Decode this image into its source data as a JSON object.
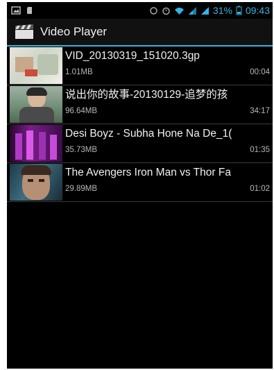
{
  "status_bar": {
    "battery_percent": "31%",
    "time": "09:43",
    "icons": [
      "image-icon",
      "sd-card-icon",
      "sync-icon",
      "alarm-icon",
      "wifi-icon",
      "signal-icon",
      "signal-icon",
      "battery-icon"
    ],
    "accent_color": "#33b5e5"
  },
  "action_bar": {
    "title": "Video Player",
    "icon": "clapperboard-icon"
  },
  "videos": [
    {
      "title": "VID_20130319_151020.3gp",
      "size": "1.01MB",
      "duration": "00:04"
    },
    {
      "title": "说出你的故事-20130129-追梦的孩",
      "size": "96.64MB",
      "duration": "34:17"
    },
    {
      "title": "Desi Boyz - Subha Hone Na De_1(",
      "size": "35.73MB",
      "duration": "01:35"
    },
    {
      "title": "The Avengers Iron Man vs Thor Fa",
      "size": "29.89MB",
      "duration": "01:02"
    }
  ]
}
